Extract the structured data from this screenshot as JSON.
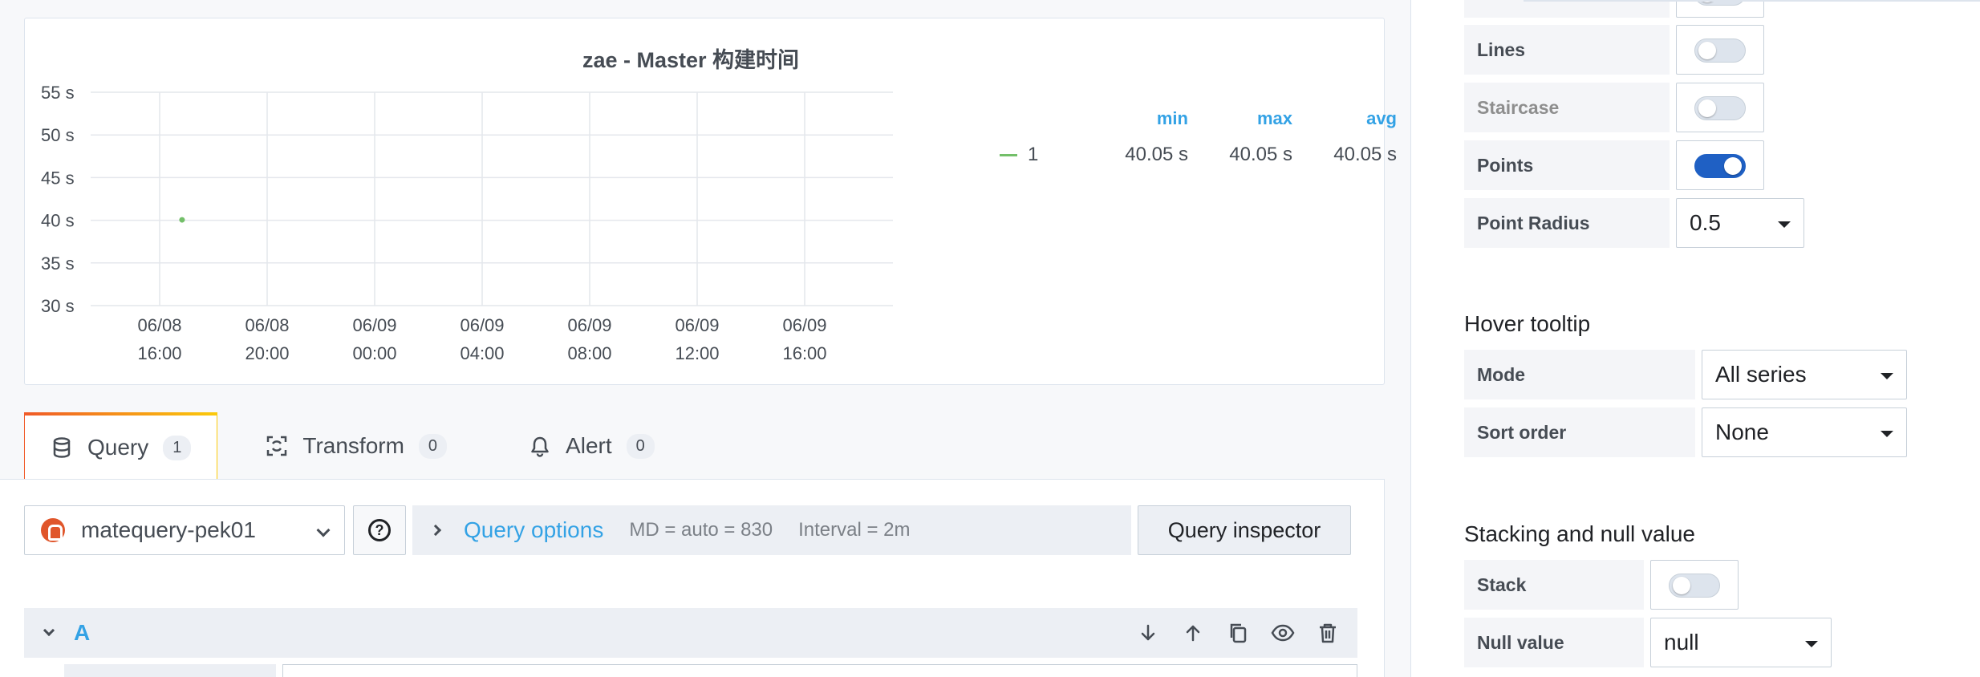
{
  "panel": {
    "title": "zae - Master 构建时间"
  },
  "chart_data": {
    "type": "scatter",
    "title": "zae - Master 构建时间",
    "y_ticks": [
      "55 s",
      "50 s",
      "45 s",
      "40 s",
      "35 s",
      "30 s"
    ],
    "ylim": [
      30,
      55
    ],
    "y_unit": "s",
    "x_ticks": [
      {
        "date": "06/08",
        "time": "16:00"
      },
      {
        "date": "06/08",
        "time": "20:00"
      },
      {
        "date": "06/09",
        "time": "00:00"
      },
      {
        "date": "06/09",
        "time": "04:00"
      },
      {
        "date": "06/09",
        "time": "08:00"
      },
      {
        "date": "06/09",
        "time": "12:00"
      },
      {
        "date": "06/09",
        "time": "16:00"
      }
    ],
    "grid": true,
    "legend_placement": "right",
    "series": [
      {
        "name": "1",
        "color": "#73bf69",
        "points": [
          {
            "x": "06/08 16:50",
            "y": 40.05
          }
        ]
      }
    ]
  },
  "legend": {
    "headers": {
      "min": "min",
      "max": "max",
      "avg": "avg"
    },
    "rows": [
      {
        "name": "1",
        "min": "40.05 s",
        "max": "40.05 s",
        "avg": "40.05 s",
        "color": "#73bf69"
      }
    ]
  },
  "tabs": [
    {
      "label": "Query",
      "count": "1",
      "icon": "database-icon",
      "active": true
    },
    {
      "label": "Transform",
      "count": "0",
      "icon": "transform-icon",
      "active": false
    },
    {
      "label": "Alert",
      "count": "0",
      "icon": "bell-icon",
      "active": false
    }
  ],
  "query": {
    "datasource": "matequery-pek01",
    "options_label": "Query options",
    "md": "MD = auto = 830",
    "interval": "Interval = 2m",
    "inspector_label": "Query inspector",
    "row_name": "A"
  },
  "display": {
    "lines_label": "Lines",
    "lines_on": false,
    "staircase_label": "Staircase",
    "staircase_on": false,
    "points_label": "Points",
    "points_on": true,
    "point_radius_label": "Point Radius",
    "point_radius_value": "0.5"
  },
  "hover_tooltip": {
    "title": "Hover tooltip",
    "mode_label": "Mode",
    "mode_value": "All series",
    "sort_label": "Sort order",
    "sort_value": "None"
  },
  "stacking": {
    "title": "Stacking and null value",
    "stack_label": "Stack",
    "stack_on": false,
    "null_label": "Null value",
    "null_value": "null"
  },
  "colors": {
    "accent_blue": "#33a2e5",
    "switch_on": "#1f60c4",
    "series_green": "#73bf69"
  }
}
